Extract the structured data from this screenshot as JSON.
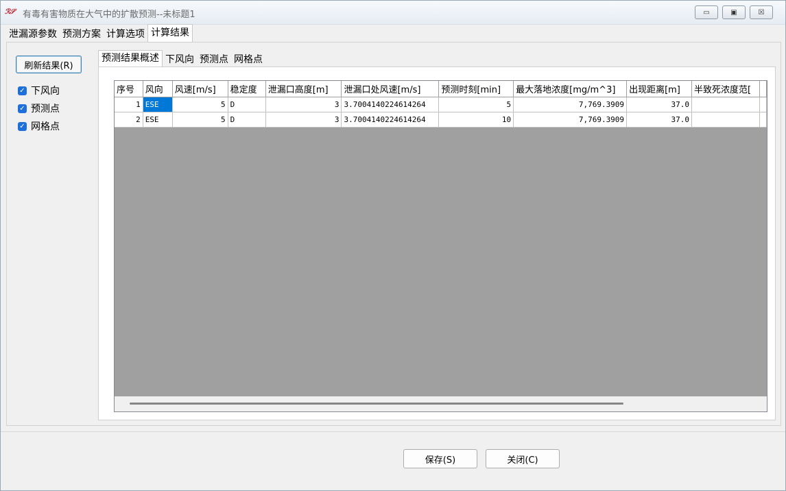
{
  "window": {
    "app_icon_text": "ℛ𝒮",
    "title": "有毒有害物质在大气中的扩散预测--未标题1",
    "buttons": [
      "minimize-icon",
      "maximize-icon",
      "close-icon"
    ]
  },
  "outer_tabs": [
    {
      "label": "泄漏源参数"
    },
    {
      "label": "预测方案"
    },
    {
      "label": "计算选项"
    },
    {
      "label": "计算结果"
    }
  ],
  "left_panel": {
    "refresh_label": "刷新结果(R)",
    "checkboxes": [
      {
        "label": "下风向",
        "checked": true
      },
      {
        "label": "预测点",
        "checked": true
      },
      {
        "label": "网格点",
        "checked": true
      }
    ]
  },
  "inner_tabs": [
    {
      "label": "预测结果概述"
    },
    {
      "label": "下风向"
    },
    {
      "label": "预测点"
    },
    {
      "label": "网格点"
    }
  ],
  "table": {
    "columns": [
      "序号",
      "风向",
      "风速[m/s]",
      "稳定度",
      "泄漏口高度[m]",
      "泄漏口处风速[m/s]",
      "预测时刻[min]",
      "最大落地浓度[mg/m^3]",
      "出现距离[m]",
      "半致死浓度范[",
      ""
    ],
    "rows": [
      [
        "1",
        "ESE",
        "5",
        "D",
        "3",
        "3.7004140224614264",
        "5",
        "7,769.3909",
        "37.0",
        "",
        ""
      ],
      [
        "2",
        "ESE",
        "5",
        "D",
        "3",
        "3.7004140224614264",
        "10",
        "7,769.3909",
        "37.0",
        "",
        ""
      ]
    ]
  },
  "footer": {
    "save_label": "保存(S)",
    "close_label": "关闭(C)"
  }
}
